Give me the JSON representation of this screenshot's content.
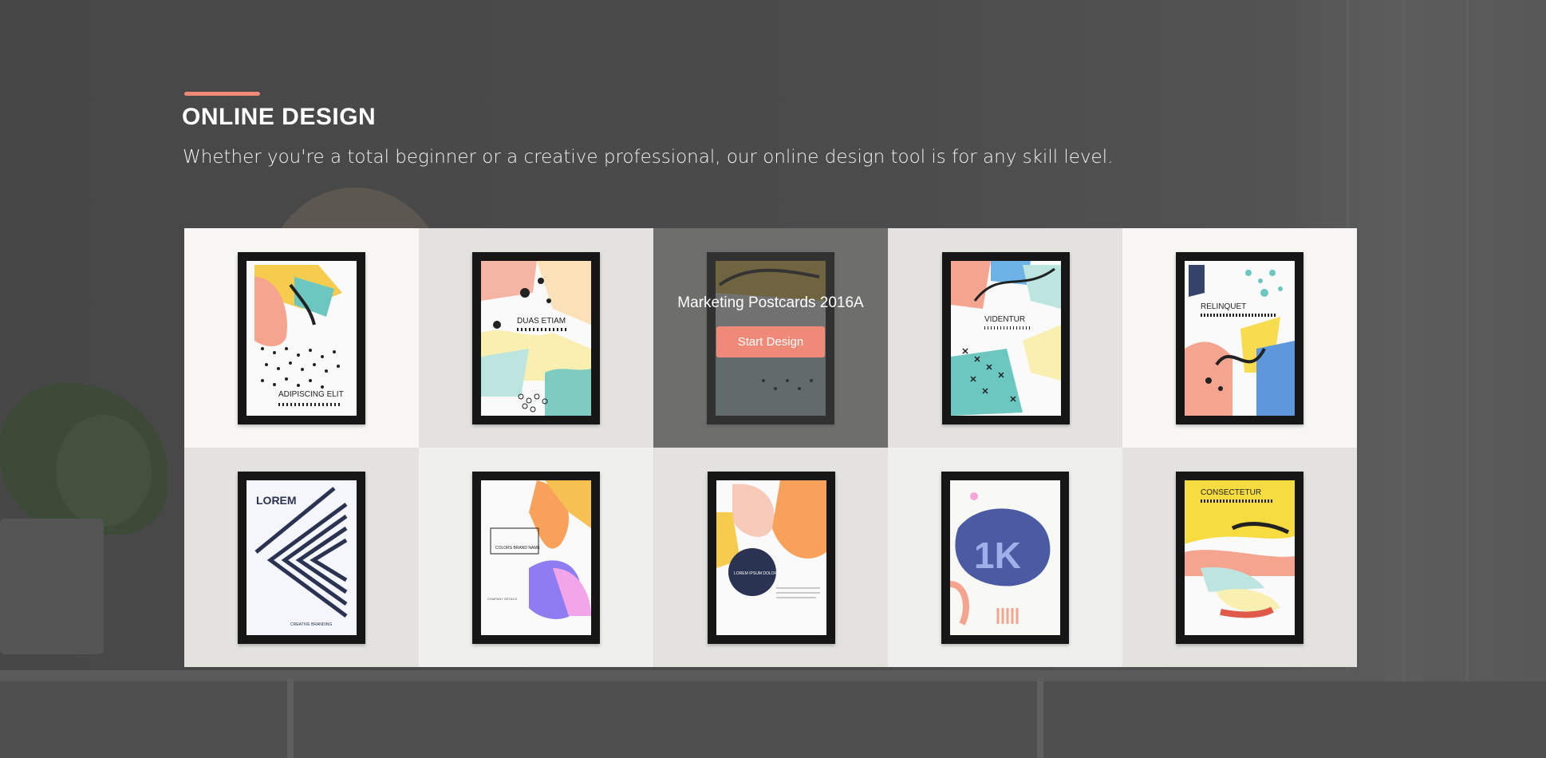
{
  "section": {
    "heading": "ONLINE DESIGN",
    "subtitle": "Whether you're a total beginner or a creative professional, our online design tool is for any skill level."
  },
  "accent_color": "#f08a78",
  "templates": [
    {
      "poster_text": "ADIPISCING ELIT",
      "hovered": false
    },
    {
      "poster_text": "DUAS ETIAM",
      "hovered": false
    },
    {
      "poster_text": "",
      "hovered": true,
      "overlay_title": "Marketing Postcards 2016A",
      "overlay_button": "Start Design"
    },
    {
      "poster_text": "VIDENTUR",
      "hovered": false
    },
    {
      "poster_text": "RELINQUET",
      "hovered": false
    },
    {
      "poster_text": "LOREM",
      "small_text": "CREATIVE BRANDING",
      "hovered": false
    },
    {
      "poster_text": "COLORS BRAND NAME",
      "small_text": "COMPANY DETAILS",
      "hovered": false
    },
    {
      "poster_text": "LOREM IPSUM DOLOR",
      "hovered": false
    },
    {
      "poster_text": "1K",
      "hovered": false
    },
    {
      "poster_text": "CONSECTETUR",
      "hovered": false
    }
  ]
}
